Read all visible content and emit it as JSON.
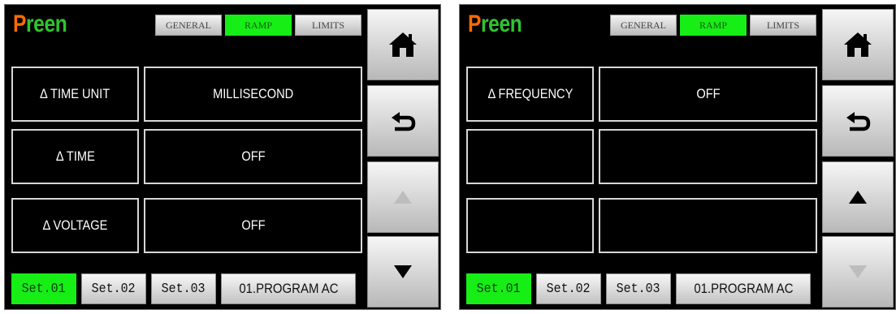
{
  "panels": [
    {
      "logo": {
        "first": "P",
        "rest": "reen"
      },
      "tabs": [
        {
          "label": "GENERAL",
          "active": false
        },
        {
          "label": "RAMP",
          "active": true
        },
        {
          "label": "LIMITS",
          "active": false
        }
      ],
      "rows": [
        {
          "label": "Δ TIME UNIT",
          "value": "MILLISECOND"
        },
        {
          "label": "Δ TIME",
          "value": "OFF"
        },
        {
          "label": "Δ VOLTAGE",
          "value": "OFF"
        }
      ],
      "nav": [
        "home-icon",
        "back-arrow-icon",
        "up-arrow-icon",
        "down-arrow-icon"
      ],
      "nav_state": {
        "up": "disabled",
        "down": "enabled"
      },
      "sets": [
        {
          "label": "Set.01",
          "active": true
        },
        {
          "label": "Set.02",
          "active": false
        },
        {
          "label": "Set.03",
          "active": false
        }
      ],
      "program": "01.PROGRAM AC"
    },
    {
      "logo": {
        "first": "P",
        "rest": "reen"
      },
      "tabs": [
        {
          "label": "GENERAL",
          "active": false
        },
        {
          "label": "RAMP",
          "active": true
        },
        {
          "label": "LIMITS",
          "active": false
        }
      ],
      "rows": [
        {
          "label": "Δ FREQUENCY",
          "value": "OFF"
        },
        {
          "label": "",
          "value": ""
        },
        {
          "label": "",
          "value": ""
        }
      ],
      "nav": [
        "home-icon",
        "back-arrow-icon",
        "up-arrow-icon",
        "down-arrow-icon"
      ],
      "nav_state": {
        "up": "enabled",
        "down": "disabled"
      },
      "sets": [
        {
          "label": "Set.01",
          "active": true
        },
        {
          "label": "Set.02",
          "active": false
        },
        {
          "label": "Set.03",
          "active": false
        }
      ],
      "program": "01.PROGRAM AC"
    }
  ],
  "colors": {
    "active_green": "#16ee16",
    "logo_orange": "#ff6a00",
    "logo_green": "#2fc52f",
    "background": "#000000"
  }
}
